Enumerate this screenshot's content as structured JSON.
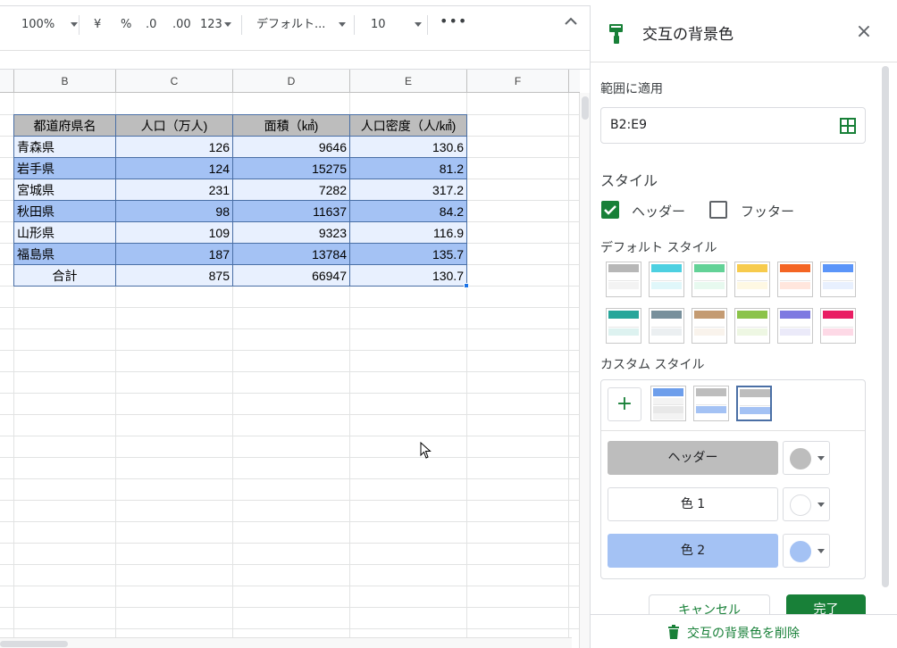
{
  "toolbar": {
    "zoom": "100%",
    "currency": "¥",
    "percent": "%",
    "decrease_decimal": ".0",
    "increase_decimal": ".00",
    "format_more": "123",
    "font": "デフォルト...",
    "font_size": "10",
    "more_icon": "more-horiz-icon",
    "collapse_icon": "chevron-up-icon"
  },
  "columns": [
    "B",
    "C",
    "D",
    "E",
    "F"
  ],
  "table": {
    "headers": [
      "都道府県名",
      "人口（万人)",
      "面積（㎢)",
      "人口密度（人/㎢)"
    ],
    "rows": [
      [
        "青森県",
        "126",
        "9646",
        "130.6"
      ],
      [
        "岩手県",
        "124",
        "15275",
        "81.2"
      ],
      [
        "宮城県",
        "231",
        "7282",
        "317.2"
      ],
      [
        "秋田県",
        "98",
        "11637",
        "84.2"
      ],
      [
        "山形県",
        "109",
        "9323",
        "116.9"
      ],
      [
        "福島県",
        "187",
        "13784",
        "135.7"
      ]
    ],
    "footer": [
      "合計",
      "875",
      "66947",
      "130.7"
    ],
    "header_color": "#bdbdbd",
    "color1": "#e8f0fe",
    "color2": "#a4c2f4"
  },
  "panel": {
    "title": "交互の背景色",
    "apply_range_label": "範囲に適用",
    "range_value": "B2:E9",
    "style_label": "スタイル",
    "header_checkbox_label": "ヘッダー",
    "header_checked": true,
    "footer_checkbox_label": "フッター",
    "footer_checked": false,
    "default_styles_label": "デフォルト スタイル",
    "default_styles": [
      {
        "header": "#b7b7b7",
        "band": "#f3f3f3"
      },
      {
        "header": "#4dd0e1",
        "band": "#e0f7fa"
      },
      {
        "header": "#63d297",
        "band": "#e7f9ef"
      },
      {
        "header": "#f7cb4d",
        "band": "#fef8e3"
      },
      {
        "header": "#f46524",
        "band": "#ffe6dd"
      },
      {
        "header": "#5b95f9",
        "band": "#e8f0fe"
      },
      {
        "header": "#26a69a",
        "band": "#ddf2f0"
      },
      {
        "header": "#78909c",
        "band": "#ebeff1"
      },
      {
        "header": "#c49b72",
        "band": "#f9f3ec"
      },
      {
        "header": "#8bc34a",
        "band": "#eef7e3"
      },
      {
        "header": "#7e7ae1",
        "band": "#ebeaf9"
      },
      {
        "header": "#e91d63",
        "band": "#fdd9e6"
      }
    ],
    "custom_styles_label": "カスタム スタイル",
    "custom_styles": [
      {
        "header": "#6d9eeb",
        "band1": "#f3f3f3",
        "band2": "#e8e8e8"
      },
      {
        "header": "#bdbdbd",
        "band1": "#ffffff",
        "band2": "#a4c2f4"
      },
      {
        "header": "#bdbdbd",
        "band1": "#ffffff",
        "band2": "#a4c2f4"
      }
    ],
    "header_button": "ヘッダー",
    "color1_button": "色 1",
    "color2_button": "色 2",
    "header_dot": "#bdbdbd",
    "color1_dot": "#ffffff",
    "color2_dot": "#a4c2f4",
    "cancel_button": "キャンセル",
    "done_button": "完了",
    "remove_link": "交互の背景色を削除"
  }
}
